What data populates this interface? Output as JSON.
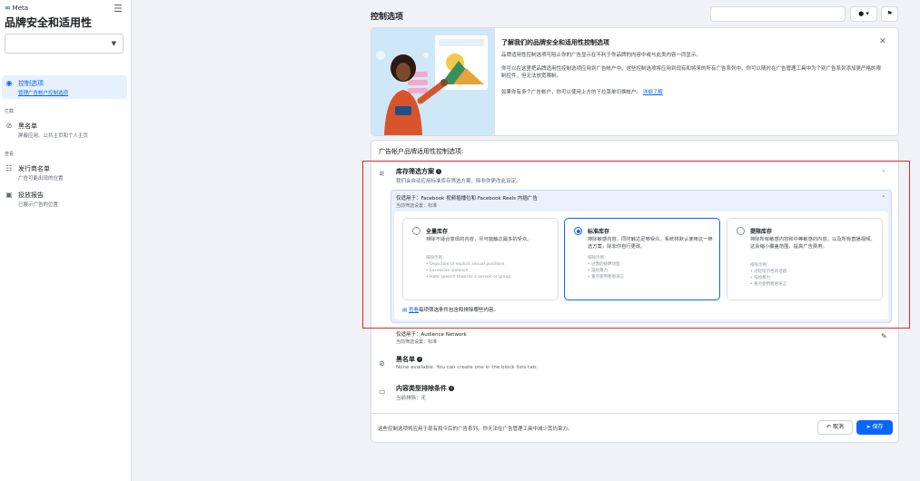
{
  "sidebar": {
    "logo": "Meta",
    "title": "品牌安全和适用性",
    "menu_icon": "hamburger-icon",
    "account_select": {
      "value": ""
    },
    "items": [
      {
        "label": "控制选项",
        "sub": "管理广告帐户控制选项",
        "icon": "radio-target-icon",
        "active": true
      },
      {
        "label": "黑名单",
        "sub": "屏蔽应用、公共主页和个人主页",
        "icon": "block-icon"
      },
      {
        "label": "发行商名单",
        "sub": "广告可能出现的位置",
        "icon": "list-icon"
      },
      {
        "label": "投放报告",
        "sub": "已展示广告的位置",
        "icon": "report-icon"
      }
    ],
    "section_labels": [
      "拦截",
      "查看"
    ]
  },
  "header": {
    "title": "控制选项",
    "search_placeholder": "",
    "help_icon": "help-icon",
    "flag_icon": "flag-icon"
  },
  "intro": {
    "title": "了解我们的品牌安全和适用性控制选项",
    "p1": "品牌适用性控制选项可阻止你的广告显示在不利于你品牌的内容中或与此类内容一同显示。",
    "p2": "你可以在这里把品牌适用性控制选项应用到广告帐户中。这些控制选项将应用到现有和将来的所有广告系列中。你可以随时在广告管理工具中为个别广告系列添加更严格的限制控件，但无法放宽限制。",
    "p3_a": "如果你有多个广告帐户，你可以使用上方的下拉菜单切换帐户。",
    "p3_link": "详细了解",
    "close_icon": "close-icon"
  },
  "controls": {
    "heading": "广告帐户品牌适用性控制选项:",
    "inventory": {
      "title": "库存筛选方案",
      "sub": "我们会自动应用标准库存筛选方案，除非你更改此设定。",
      "applies_to": "仅适用于：Facebook 视频插播位和 Facebook Reels 内插广告",
      "current": "当前筛选设置：标准",
      "options": [
        {
          "title": "全量库存",
          "desc": "排除不适合变现的内容，尽可能触达最多的受众。",
          "ex_label": "排除示例：",
          "examples": [
            "• Depiction of explicit sexual positions",
            "• Excessive violence",
            "• Hate speech towards a person or group"
          ],
          "selected": false
        },
        {
          "title": "标准库存",
          "desc": "排除敏感内容，同时触达足够受众。系统将默认使用这一筛选方案，除非你自行更改。",
          "ex_label": "排除示例：",
          "examples": [
            "• 过激的挑衅场面",
            "• 描绘暴力",
            "• 重点使用粗俗语言"
          ],
          "selected": true
        },
        {
          "title": "提限库存",
          "desc": "排除所有敏感内容和中等敏感的内容，以及所有直播视频。这会缩小覆盖范围，提高广告费用。",
          "ex_label": "排除示例：",
          "examples": [
            "• 过轻暗示性的话题",
            "• 描绘暴力",
            "• 重点使用粗俗语言"
          ],
          "selected": false
        }
      ],
      "view_link": "查看",
      "view_text": "每项筛选条件包含和排除哪些内容。"
    },
    "audience_network": {
      "applies_to": "仅适用于：Audience Network",
      "current": "当前筛选设置：标准"
    },
    "blocklist": {
      "title": "黑名单",
      "sub": "None available. You can create one in the block lists tab."
    },
    "content_type": {
      "title": "内容类型排除条件",
      "sub": "当前排除：无"
    }
  },
  "footer": {
    "note": "这些控制选项将应用于现有和今后的广告系列。你无法在广告管理工具中减少其约束力。",
    "undo": "取消",
    "save": "保存"
  }
}
